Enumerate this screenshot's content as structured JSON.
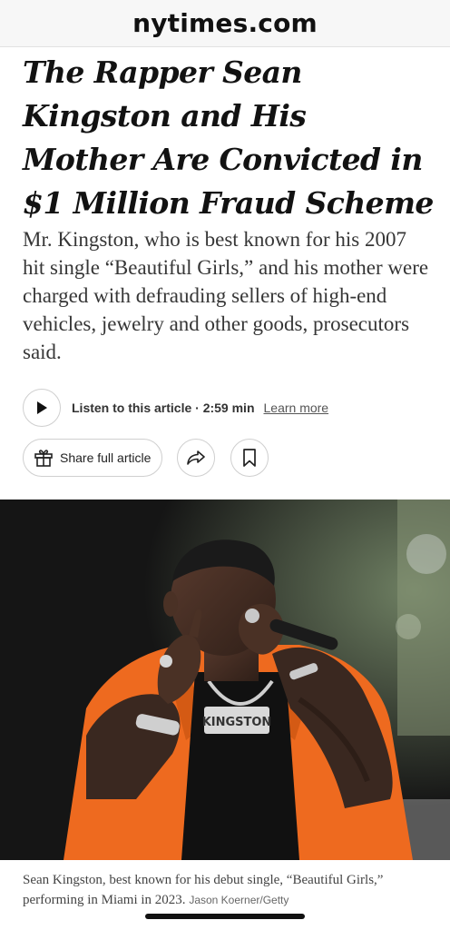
{
  "browser": {
    "domain": "nytimes.com"
  },
  "article": {
    "headline": "The Rapper Sean Kingston and His Mother Are Convicted in $1 Million Fraud Scheme",
    "summary": "Mr. Kingston, who is best known for his 2007 hit single “Beautiful Girls,” and his mother were charged with defrauding sellers of high-end vehicles, jewelry and other goods, prosecutors said."
  },
  "audio": {
    "play_icon": "play-icon",
    "label": "Listen to this article · 2:59 min",
    "learn_more": "Learn more"
  },
  "actions": {
    "share_icon": "gift-icon",
    "share_label": "Share full article",
    "forward_icon": "share-arrow-icon",
    "bookmark_icon": "bookmark-icon"
  },
  "photo": {
    "caption": "Sean Kingston, best known for his debut single, “Beautiful Girls,” performing in Miami in 2023.",
    "credit": "Jason Koerner/Getty",
    "shirt_lettering": "KINGSTON"
  },
  "colors": {
    "text": "#121212",
    "summary_text": "#363636",
    "shirt_orange": "#ee6a1f",
    "border": "#cfcfcf"
  }
}
